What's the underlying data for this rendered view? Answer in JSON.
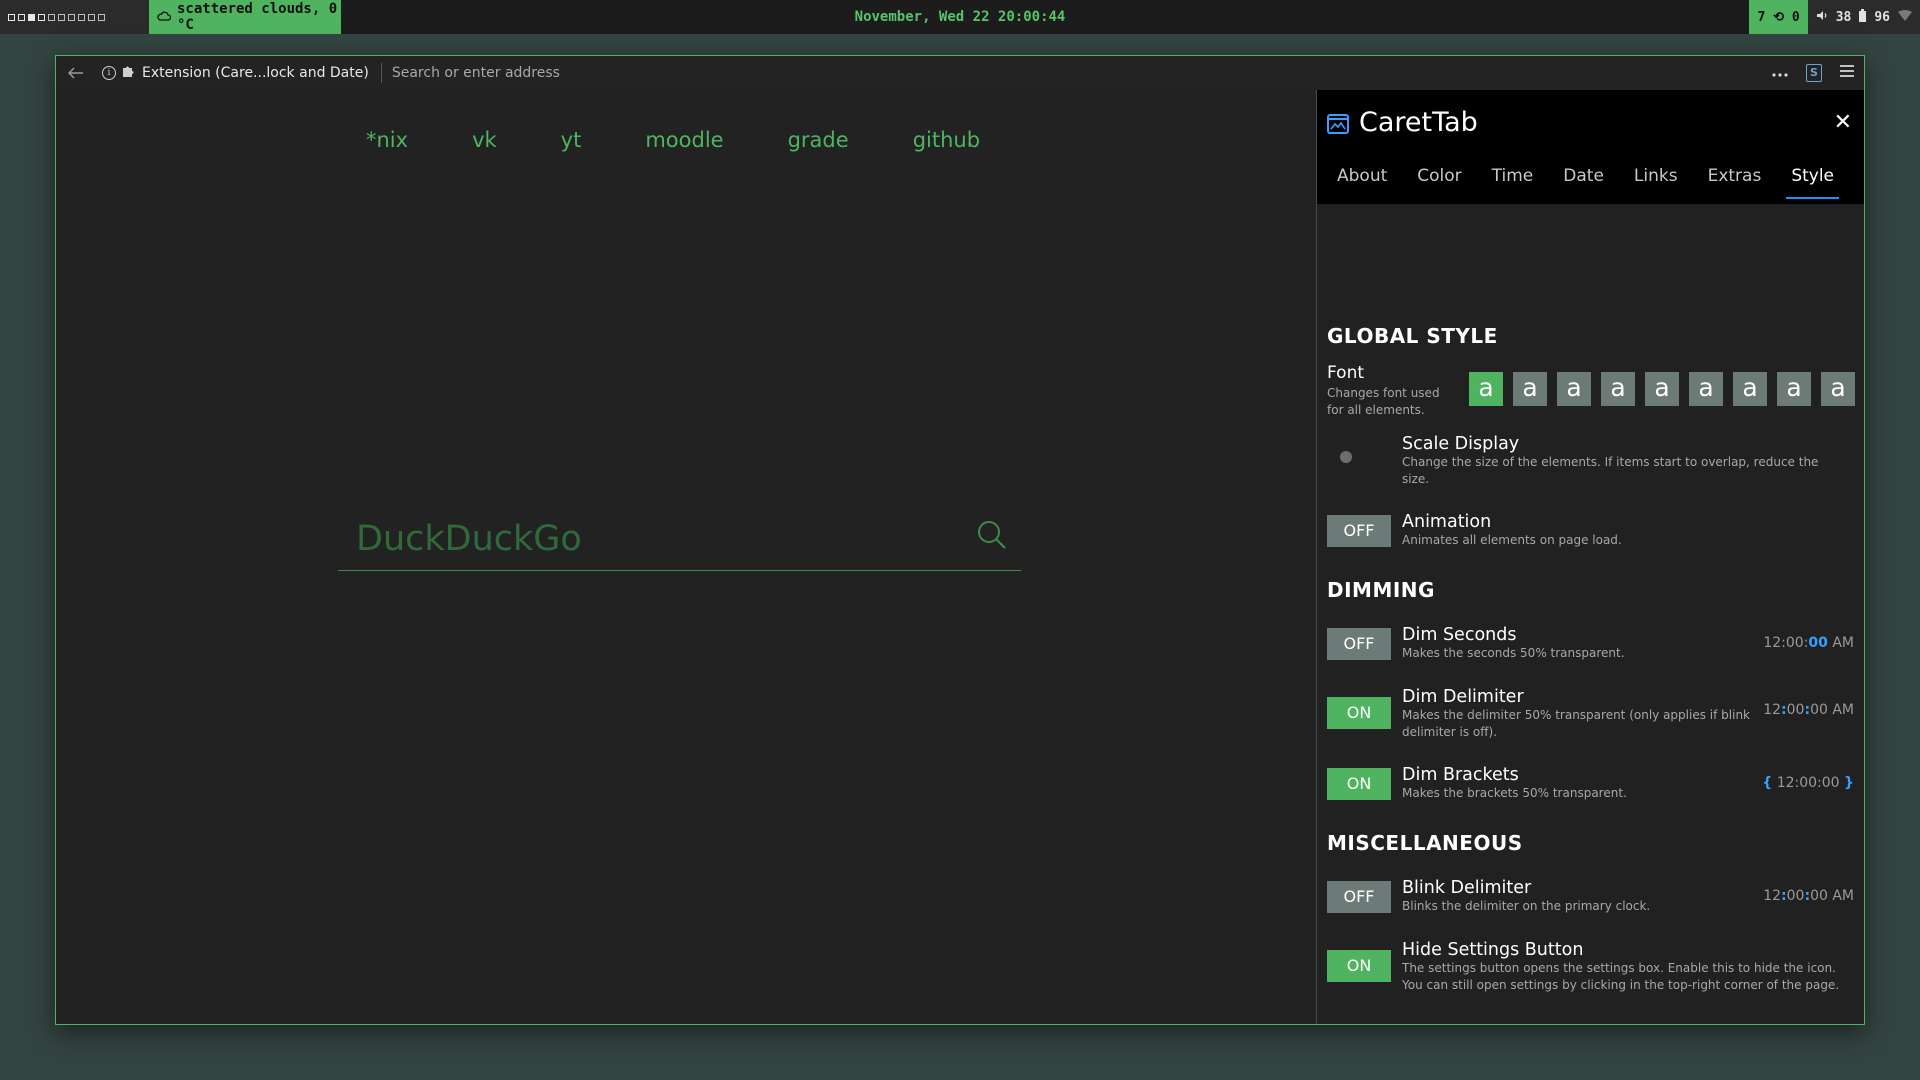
{
  "topbar": {
    "weather": "scattered clouds, 0 °C",
    "clock": "November, Wed 22 20:00:44",
    "sync": "7 ⟲ 0",
    "volume": "38",
    "battery": "96"
  },
  "browser": {
    "identity": "Extension (Care...lock and Date)",
    "address_placeholder": "Search or enter address"
  },
  "page": {
    "links": [
      "*nix",
      "vk",
      "yt",
      "moodle",
      "grade",
      "github"
    ],
    "search_placeholder": "DuckDuckGo"
  },
  "panel": {
    "title": "CaretTab",
    "tabs": [
      "About",
      "Color",
      "Time",
      "Date",
      "Links",
      "Extras",
      "Style"
    ],
    "active_tab": "Style",
    "sections": {
      "global": "GLOBAL STYLE",
      "dimming": "DIMMING",
      "misc": "MISCELLANEOUS"
    },
    "font": {
      "label": "Font",
      "desc": "Changes font used for all elements.",
      "swatches": [
        "a",
        "a",
        "a",
        "a",
        "a",
        "a",
        "a",
        "a",
        "a"
      ]
    },
    "scale": {
      "label": "Scale Display",
      "desc": "Change the size of the elements. If items start to overlap, reduce the size."
    },
    "animation": {
      "toggle": "OFF",
      "label": "Animation",
      "desc": "Animates all elements on page load."
    },
    "dim_seconds": {
      "toggle": "OFF",
      "label": "Dim Seconds",
      "desc": "Makes the seconds 50% transparent.",
      "preview_a": "12:00:",
      "preview_hl": "00",
      "preview_b": " AM"
    },
    "dim_delimiter": {
      "toggle": "ON",
      "label": "Dim Delimiter",
      "desc": "Makes the delimiter 50% transparent (only applies if blink delimiter is off).",
      "p1": "12",
      "d1": ":",
      "p2": "00",
      "d2": ":",
      "p3": "00 AM"
    },
    "dim_brackets": {
      "toggle": "ON",
      "label": "Dim Brackets",
      "desc": "Makes the brackets 50% transparent.",
      "open": "{",
      "time": " 12:00:00 ",
      "close": "}"
    },
    "blink_delimiter": {
      "toggle": "OFF",
      "label": "Blink Delimiter",
      "desc": "Blinks the delimiter on the primary clock.",
      "p1": "12",
      "d1": ":",
      "p2": "00",
      "d2": ":",
      "p3": "00 AM"
    },
    "hide_settings": {
      "toggle": "ON",
      "label": "Hide Settings Button",
      "desc": "The settings button opens the settings box. Enable this to hide the icon. You can still open settings by clicking in the top-right corner of the page."
    }
  },
  "colors": {
    "accent": "#4fb360",
    "highlight": "#3aa0ff",
    "toggle_off": "#6d7b78"
  }
}
